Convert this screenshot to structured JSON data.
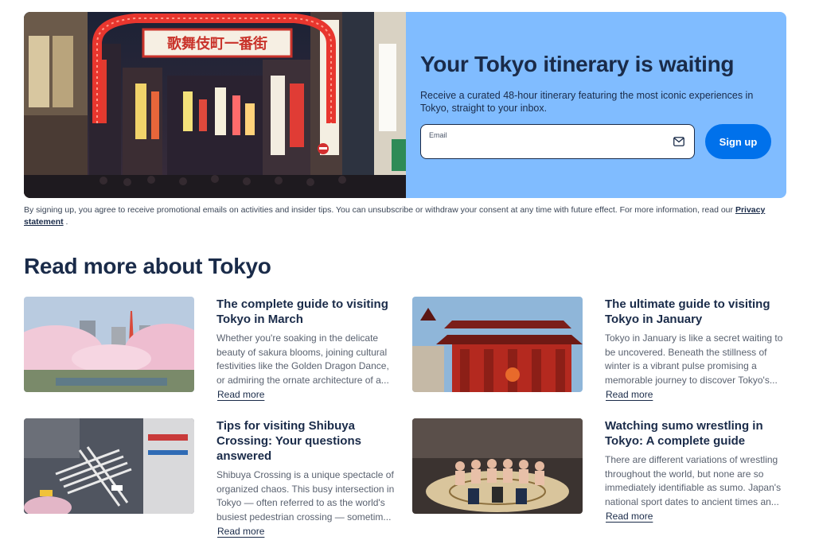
{
  "hero": {
    "title": "Your Tokyo itinerary is waiting",
    "subtitle": "Receive a curated 48-hour itinerary featuring the most iconic experiences in Tokyo, straight to your inbox.",
    "email_label": "Email",
    "email_value": "",
    "email_placeholder": "",
    "signup_label": "Sign up",
    "sign_text": "歌舞伎町一番街",
    "colors": {
      "panel": "#80bcff",
      "button": "#0071eb"
    }
  },
  "consent": {
    "text": "By signing up, you agree to receive promotional emails on activities and insider tips. You can unsubscribe or withdraw your consent at any time with future effect. For more information, read our ",
    "link": "Privacy statement",
    "suffix": " ."
  },
  "section": {
    "title": "Read more about Tokyo"
  },
  "articles": [
    {
      "title": "The complete guide to visiting Tokyo in March",
      "description": "Whether you're soaking in the delicate beauty of sakura blooms, joining cultural festivities like the Golden Dragon Dance, or admiring the ornate architecture of a...",
      "read_more": "Read more"
    },
    {
      "title": "The ultimate guide to visiting Tokyo in January",
      "description": "Tokyo in January is like a secret waiting to be uncovered. Beneath the stillness of winter is a vibrant pulse promising a memorable journey to discover Tokyo's...",
      "read_more": "Read more"
    },
    {
      "title": "Tips for visiting Shibuya Crossing: Your questions answered",
      "description": "Shibuya Crossing is a unique spectacle of organized chaos. This busy intersection in Tokyo — often referred to as the world's busiest pedestrian crossing — sometim...",
      "read_more": "Read more"
    },
    {
      "title": "Watching sumo wrestling in Tokyo: A complete guide",
      "description": "There are different variations of wrestling throughout the world, but none are so immediately identifiable as sumo. Japan's national sport dates to ancient times an...",
      "read_more": "Read more"
    }
  ]
}
